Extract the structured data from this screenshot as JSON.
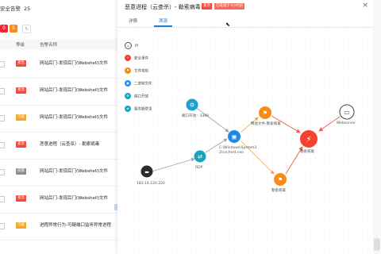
{
  "left_panel": {
    "count_label": "安全告警",
    "count_value": "25",
    "toolbar": [
      {
        "label": "0",
        "color": "#f5222d"
      },
      {
        "label": "5",
        "color": "#fa8c16"
      }
    ],
    "columns": [
      "等级",
      "告警名称"
    ],
    "rows": [
      {
        "level": "紧急",
        "level_color": "#f04b3c",
        "name": "网站后门-发现后门(Webshell)文件"
      },
      {
        "level": "紧急",
        "level_color": "#f04b3c",
        "name": "网站后门-发现后门(Webshell)文件"
      },
      {
        "level": "可疑",
        "level_color": "#f5a623",
        "name": "网站后门-发现后门(Webshell)文件"
      },
      {
        "level": "紧急",
        "level_color": "#f04b3c",
        "name": "恶意进程（云查杀）- 勒索病毒"
      },
      {
        "level": "提醒",
        "level_color": "#8c8c8c",
        "name": "网站后门-发现后门(Webshell)文件"
      },
      {
        "level": "紧急",
        "level_color": "#f04b3c",
        "name": "网站后门-发现后门(Webshell)文件"
      },
      {
        "level": "可疑",
        "level_color": "#f5a623",
        "name": "进程异常行为-可疑端口监听异常进程"
      }
    ]
  },
  "detail": {
    "title": "恶意进程（云查杀）- 勒索病毒",
    "tag_urgent": "紧急",
    "tag_extra": "已处理于3小时前",
    "tabs": [
      "详情",
      "溯源"
    ],
    "active_tab": 1
  },
  "legend": [
    {
      "label": "IP",
      "color": "#ffffff",
      "border": "#555555"
    },
    {
      "label": "安全事件",
      "color": "#f5422e",
      "border": "#f5422e"
    },
    {
      "label": "文件攻陷",
      "color": "#fa8c16",
      "border": "#fa8c16"
    },
    {
      "label": "二进制文件",
      "color": "#1890ff",
      "border": "#1890ff"
    },
    {
      "label": "端口开放",
      "color": "#13a8c2",
      "border": "#13a8c2"
    },
    {
      "label": "服务器登录",
      "color": "#13a8c2",
      "border": "#13a8c2"
    }
  ],
  "graph": {
    "nodes": {
      "svc": {
        "label": "端口开放：3389",
        "color": "#1ba0d0",
        "glyph": "⚙"
      },
      "ip": {
        "label": "183.14.120.220",
        "color": "#2b2b2b",
        "glyph": "▬"
      },
      "rdp": {
        "label": "RDP",
        "color": "#14a8c0",
        "glyph": "⇄"
      },
      "proc": {
        "label": "C:\\Windows\\System32\\svchost.exe",
        "color": "#1e88e5",
        "glyph": "▣"
      },
      "dropper": {
        "label": "释放文件-勒索病毒",
        "color": "#fa8c16",
        "glyph": "⚑"
      },
      "event": {
        "label": "勒索病毒",
        "color": "#f5422e",
        "glyph": "⚡"
      },
      "virus": {
        "label": "勒索病毒",
        "color": "#fa8c16",
        "glyph": "⚑"
      },
      "server": {
        "label": "Webserver",
        "color": "#ffffff",
        "glyph": "▭"
      }
    }
  }
}
